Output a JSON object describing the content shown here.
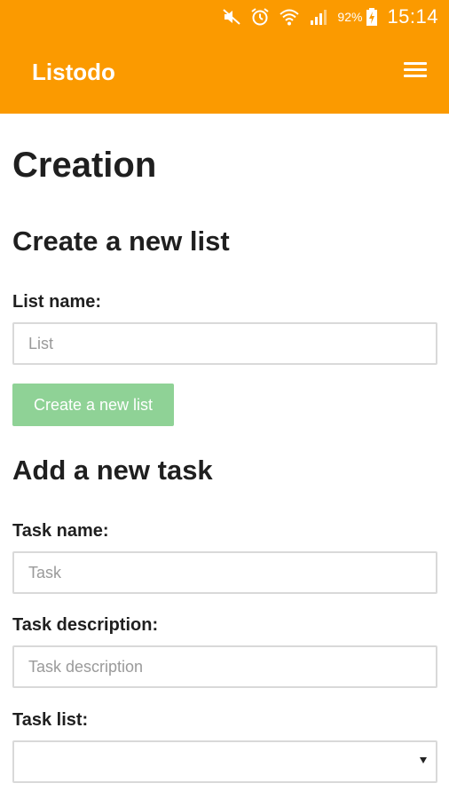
{
  "status_bar": {
    "battery_percent": "92%",
    "time": "15:14",
    "icons": [
      "mute-icon",
      "alarm-icon",
      "wifi-icon",
      "signal-icon",
      "battery-charging-icon"
    ]
  },
  "app_bar": {
    "title": "Listodo",
    "menu_icon": "hamburger-menu-icon"
  },
  "page": {
    "title": "Creation"
  },
  "create_list": {
    "heading": "Create a new list",
    "name_label": "List name:",
    "name_placeholder": "List",
    "name_value": "",
    "button_label": "Create a new list"
  },
  "add_task": {
    "heading": "Add a new task",
    "name_label": "Task name:",
    "name_placeholder": "Task",
    "name_value": "",
    "description_label": "Task description:",
    "description_placeholder": "Task description",
    "description_value": "",
    "list_label": "Task list:",
    "list_selected": ""
  },
  "colors": {
    "accent": "#fb9a00",
    "button": "#8fd296",
    "text": "#1f1f1f",
    "border": "#d9d9d9",
    "placeholder": "#9a9a9a"
  }
}
